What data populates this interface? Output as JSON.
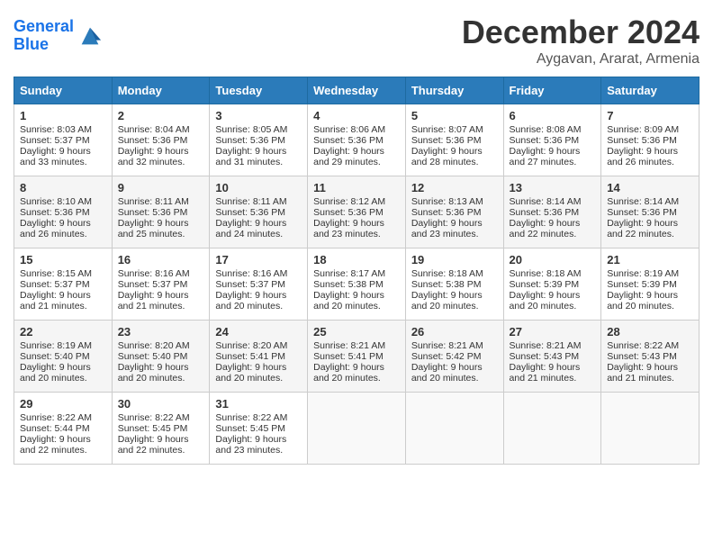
{
  "logo": {
    "line1": "General",
    "line2": "Blue"
  },
  "title": "December 2024",
  "subtitle": "Aygavan, Ararat, Armenia",
  "headers": [
    "Sunday",
    "Monday",
    "Tuesday",
    "Wednesday",
    "Thursday",
    "Friday",
    "Saturday"
  ],
  "weeks": [
    [
      {
        "day": "1",
        "rise": "Sunrise: 8:03 AM",
        "set": "Sunset: 5:37 PM",
        "daylight": "Daylight: 9 hours and 33 minutes."
      },
      {
        "day": "2",
        "rise": "Sunrise: 8:04 AM",
        "set": "Sunset: 5:36 PM",
        "daylight": "Daylight: 9 hours and 32 minutes."
      },
      {
        "day": "3",
        "rise": "Sunrise: 8:05 AM",
        "set": "Sunset: 5:36 PM",
        "daylight": "Daylight: 9 hours and 31 minutes."
      },
      {
        "day": "4",
        "rise": "Sunrise: 8:06 AM",
        "set": "Sunset: 5:36 PM",
        "daylight": "Daylight: 9 hours and 29 minutes."
      },
      {
        "day": "5",
        "rise": "Sunrise: 8:07 AM",
        "set": "Sunset: 5:36 PM",
        "daylight": "Daylight: 9 hours and 28 minutes."
      },
      {
        "day": "6",
        "rise": "Sunrise: 8:08 AM",
        "set": "Sunset: 5:36 PM",
        "daylight": "Daylight: 9 hours and 27 minutes."
      },
      {
        "day": "7",
        "rise": "Sunrise: 8:09 AM",
        "set": "Sunset: 5:36 PM",
        "daylight": "Daylight: 9 hours and 26 minutes."
      }
    ],
    [
      {
        "day": "8",
        "rise": "Sunrise: 8:10 AM",
        "set": "Sunset: 5:36 PM",
        "daylight": "Daylight: 9 hours and 26 minutes."
      },
      {
        "day": "9",
        "rise": "Sunrise: 8:11 AM",
        "set": "Sunset: 5:36 PM",
        "daylight": "Daylight: 9 hours and 25 minutes."
      },
      {
        "day": "10",
        "rise": "Sunrise: 8:11 AM",
        "set": "Sunset: 5:36 PM",
        "daylight": "Daylight: 9 hours and 24 minutes."
      },
      {
        "day": "11",
        "rise": "Sunrise: 8:12 AM",
        "set": "Sunset: 5:36 PM",
        "daylight": "Daylight: 9 hours and 23 minutes."
      },
      {
        "day": "12",
        "rise": "Sunrise: 8:13 AM",
        "set": "Sunset: 5:36 PM",
        "daylight": "Daylight: 9 hours and 23 minutes."
      },
      {
        "day": "13",
        "rise": "Sunrise: 8:14 AM",
        "set": "Sunset: 5:36 PM",
        "daylight": "Daylight: 9 hours and 22 minutes."
      },
      {
        "day": "14",
        "rise": "Sunrise: 8:14 AM",
        "set": "Sunset: 5:36 PM",
        "daylight": "Daylight: 9 hours and 22 minutes."
      }
    ],
    [
      {
        "day": "15",
        "rise": "Sunrise: 8:15 AM",
        "set": "Sunset: 5:37 PM",
        "daylight": "Daylight: 9 hours and 21 minutes."
      },
      {
        "day": "16",
        "rise": "Sunrise: 8:16 AM",
        "set": "Sunset: 5:37 PM",
        "daylight": "Daylight: 9 hours and 21 minutes."
      },
      {
        "day": "17",
        "rise": "Sunrise: 8:16 AM",
        "set": "Sunset: 5:37 PM",
        "daylight": "Daylight: 9 hours and 20 minutes."
      },
      {
        "day": "18",
        "rise": "Sunrise: 8:17 AM",
        "set": "Sunset: 5:38 PM",
        "daylight": "Daylight: 9 hours and 20 minutes."
      },
      {
        "day": "19",
        "rise": "Sunrise: 8:18 AM",
        "set": "Sunset: 5:38 PM",
        "daylight": "Daylight: 9 hours and 20 minutes."
      },
      {
        "day": "20",
        "rise": "Sunrise: 8:18 AM",
        "set": "Sunset: 5:39 PM",
        "daylight": "Daylight: 9 hours and 20 minutes."
      },
      {
        "day": "21",
        "rise": "Sunrise: 8:19 AM",
        "set": "Sunset: 5:39 PM",
        "daylight": "Daylight: 9 hours and 20 minutes."
      }
    ],
    [
      {
        "day": "22",
        "rise": "Sunrise: 8:19 AM",
        "set": "Sunset: 5:40 PM",
        "daylight": "Daylight: 9 hours and 20 minutes."
      },
      {
        "day": "23",
        "rise": "Sunrise: 8:20 AM",
        "set": "Sunset: 5:40 PM",
        "daylight": "Daylight: 9 hours and 20 minutes."
      },
      {
        "day": "24",
        "rise": "Sunrise: 8:20 AM",
        "set": "Sunset: 5:41 PM",
        "daylight": "Daylight: 9 hours and 20 minutes."
      },
      {
        "day": "25",
        "rise": "Sunrise: 8:21 AM",
        "set": "Sunset: 5:41 PM",
        "daylight": "Daylight: 9 hours and 20 minutes."
      },
      {
        "day": "26",
        "rise": "Sunrise: 8:21 AM",
        "set": "Sunset: 5:42 PM",
        "daylight": "Daylight: 9 hours and 20 minutes."
      },
      {
        "day": "27",
        "rise": "Sunrise: 8:21 AM",
        "set": "Sunset: 5:43 PM",
        "daylight": "Daylight: 9 hours and 21 minutes."
      },
      {
        "day": "28",
        "rise": "Sunrise: 8:22 AM",
        "set": "Sunset: 5:43 PM",
        "daylight": "Daylight: 9 hours and 21 minutes."
      }
    ],
    [
      {
        "day": "29",
        "rise": "Sunrise: 8:22 AM",
        "set": "Sunset: 5:44 PM",
        "daylight": "Daylight: 9 hours and 22 minutes."
      },
      {
        "day": "30",
        "rise": "Sunrise: 8:22 AM",
        "set": "Sunset: 5:45 PM",
        "daylight": "Daylight: 9 hours and 22 minutes."
      },
      {
        "day": "31",
        "rise": "Sunrise: 8:22 AM",
        "set": "Sunset: 5:45 PM",
        "daylight": "Daylight: 9 hours and 23 minutes."
      },
      null,
      null,
      null,
      null
    ]
  ]
}
